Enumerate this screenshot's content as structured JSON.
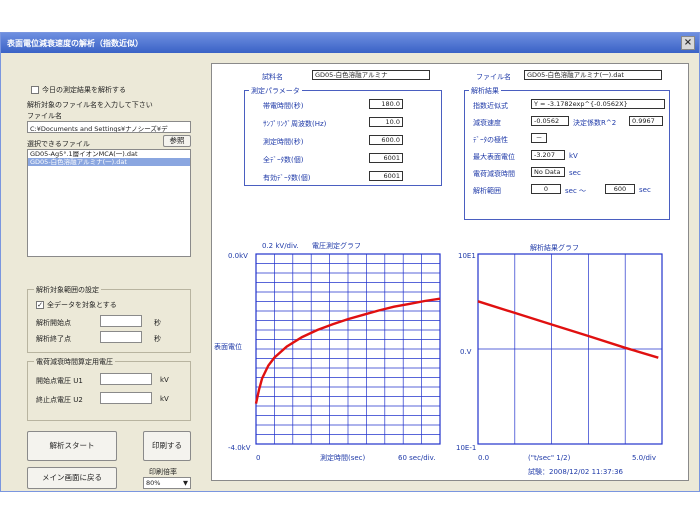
{
  "window": {
    "title": "表面電位減衰速度の解析（指数近似）",
    "close_glyph": "×"
  },
  "left": {
    "analyze_today_label": "今日の測定結果を解析する",
    "input_prompt": "解析対象のファイル名を入力して下さい",
    "filename_label": "ファイル名",
    "filename_value": "C:¥Documents and Settings¥ナノシーズ¥デ",
    "browse_button": "参照",
    "selectable_files_label": "選択できるファイル",
    "files": [
      "GD05-Ag5°.1層イオンMCA(一).dat",
      "GD05-白色溶融アルミナ(一).dat"
    ],
    "selected_file_index": 1,
    "range_group_title": "解析対象範囲の設定",
    "all_data_label": "全データを対象とする",
    "all_data_checked": true,
    "start_point_label": "解析開始点",
    "end_point_label": "解析終了点",
    "seconds_unit": "秒",
    "voltage_group_title": "電荷減衰時間算定用電圧",
    "start_voltage_label": "開始点電圧 U1",
    "end_voltage_label": "終止点電圧 U2",
    "volt_unit": "kV",
    "start_analysis_button": "解析スタート",
    "print_button": "印刷する",
    "return_main_button": "メイン画面に戻る",
    "print_scale_label": "印刷倍率",
    "print_scale_value": "80%"
  },
  "main": {
    "sample_label": "試料名",
    "sample_value": "GD05-白色溶融アルミナ",
    "file_label": "ファイル名",
    "file_value": "GD05-白色溶融アルミナ(一).dat",
    "params_title": "測定パラメータ",
    "params": [
      {
        "label": "帯電時間(秒)",
        "value": "180.0"
      },
      {
        "label": "ｻﾝﾌﾟﾘﾝｸﾞ周波数(Hz)",
        "value": "10.0"
      },
      {
        "label": "測定時間(秒)",
        "value": "600.0"
      },
      {
        "label": "全ﾃﾞｰﾀ数(個)",
        "value": "6001"
      },
      {
        "label": "有効ﾃﾞｰﾀ数(個)",
        "value": "6001"
      }
    ],
    "results_title": "解析結果",
    "fit_label": "指数近似式",
    "fit_value": "Y = -3.1782exp^{-0.0562X}",
    "decay_label": "減衰速度",
    "decay_value": "-0.0562",
    "r2_label": "決定係数R^2",
    "r2_value": "0.9967",
    "polarity_label": "ﾃﾞｰﾀの極性",
    "polarity_value": "－",
    "max_potential_label": "最大表面電位",
    "max_potential_value": "-3.207",
    "max_potential_unit": "kV",
    "decay_time_label": "電荷減衰時間",
    "decay_time_value": "No Data",
    "decay_time_unit": "sec",
    "range_label": "解析範囲",
    "range_start": "0",
    "range_mid": "sec ～",
    "range_end": "600",
    "range_unit": "sec",
    "date_text": "試験：2008/12/02 11:37:36"
  },
  "chart_data": [
    {
      "type": "line",
      "title": "電圧測定グラフ",
      "scale_label": "0.2 kV/div.",
      "ylabel": "表面電位",
      "xlabel": "測定時間(sec)",
      "y_top_label": "0.0kV",
      "y_bottom_label": "-4.0kV",
      "x_left_label": "0",
      "x_right_label": "60 sec/div.",
      "xlim": [
        0,
        600
      ],
      "ylim": [
        -4.0,
        0.0
      ],
      "grid": true,
      "series": [
        {
          "color": "#e01010",
          "x": [
            0,
            10,
            20,
            40,
            60,
            100,
            150,
            200,
            250,
            300,
            350,
            400,
            450,
            500,
            550,
            600
          ],
          "y": [
            -3.15,
            -2.85,
            -2.62,
            -2.35,
            -2.18,
            -1.95,
            -1.75,
            -1.6,
            -1.48,
            -1.37,
            -1.28,
            -1.19,
            -1.11,
            -1.05,
            -0.99,
            -0.94
          ]
        }
      ]
    },
    {
      "type": "line",
      "title": "解析結果グラフ",
      "y_top_label": "10E1",
      "y_mid_label": "0.V",
      "y_bottom_label": "10E-1",
      "x_left_label": "0.0",
      "x_mid_label": "(\"t/sec\" 1/2)",
      "x_right_label": "5.0/div",
      "xlim": [
        0,
        25
      ],
      "ylim_log10": [
        -1,
        1
      ],
      "grid": true,
      "series": [
        {
          "color": "#e01010",
          "x": [
            0,
            5,
            10,
            15,
            20,
            24.5
          ],
          "y": [
            3.18,
            2.4,
            1.81,
            1.37,
            1.03,
            0.81
          ]
        }
      ]
    }
  ]
}
